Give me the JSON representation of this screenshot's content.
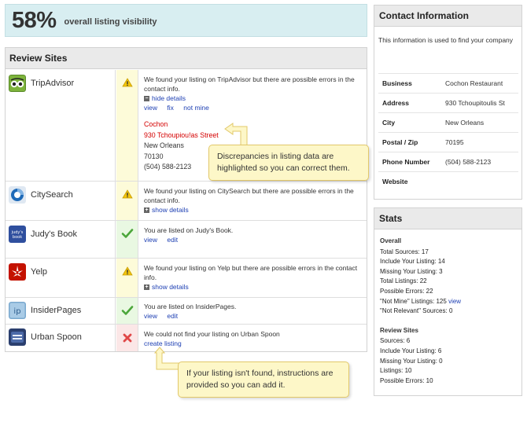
{
  "visibility": {
    "percent": "58%",
    "label": "overall listing visibility"
  },
  "review_sites": {
    "title": "Review Sites",
    "sites": [
      {
        "name": "TripAdvisor",
        "status": "warning",
        "message": "We found your listing on TripAdvisor but there are possible errors in the contact info.",
        "toggle": "hide details",
        "links": [
          "view",
          "fix",
          "not mine"
        ],
        "details": [
          "Cochon",
          "930 Tchoupiou!as Street",
          "New Orleans",
          "70130",
          "(504) 588-2123"
        ]
      },
      {
        "name": "CitySearch",
        "status": "warning",
        "message": "We found your listing on CitySearch but there are possible errors in the contact info.",
        "toggle": "show details"
      },
      {
        "name": "Judy's Book",
        "status": "ok",
        "message": "You are listed on Judy's Book.",
        "links": [
          "view",
          "edit"
        ]
      },
      {
        "name": "Yelp",
        "status": "warning",
        "message": "We found your listing on Yelp but there are possible errors in the contact info.",
        "toggle": "show details"
      },
      {
        "name": "InsiderPages",
        "status": "ok",
        "message": "You are listed on InsiderPages.",
        "links": [
          "view",
          "edit"
        ]
      },
      {
        "name": "Urban Spoon",
        "status": "error",
        "message": "We could not find your listing on Urban Spoon",
        "action": "create listing"
      }
    ]
  },
  "callouts": {
    "discrepancies": "Discrepancies in listing data are highlighted so you can correct them.",
    "not_found": "If your listing isn't found, instructions are provided so you can add it."
  },
  "contact": {
    "title": "Contact Information",
    "intro": "This information is used to find your company",
    "rows": [
      {
        "label": "Business",
        "value": "Cochon Restaurant"
      },
      {
        "label": "Address",
        "value": "930 Tchoupitoulis St"
      },
      {
        "label": "City",
        "value": "New Orleans"
      },
      {
        "label": "Postal / Zip",
        "value": "70195"
      },
      {
        "label": "Phone Number",
        "value": "(504) 588-2123"
      },
      {
        "label": "Website",
        "value": ""
      }
    ]
  },
  "stats": {
    "title": "Stats",
    "overall_heading": "Overall",
    "overall": [
      "Total Sources: 17",
      "Include Your Listing: 14",
      "Missing Your Listing: 3",
      "Total Listings: 22",
      "Possible Errors: 22",
      "\"Not Mine\" Listings: 125",
      "\"Not Relevant\" Sources: 0"
    ],
    "not_mine_link": "view",
    "review_heading": "Review Sites",
    "review": [
      "Sources: 6",
      "Include Your Listing: 6",
      "Missing Your Listing: 0",
      "Listings: 10",
      "Possible Errors: 10"
    ]
  },
  "colors": {
    "link": "#1d3fb3",
    "error_text": "#d40000",
    "banner": "#d8eef1",
    "callout": "#fdf7c8"
  }
}
